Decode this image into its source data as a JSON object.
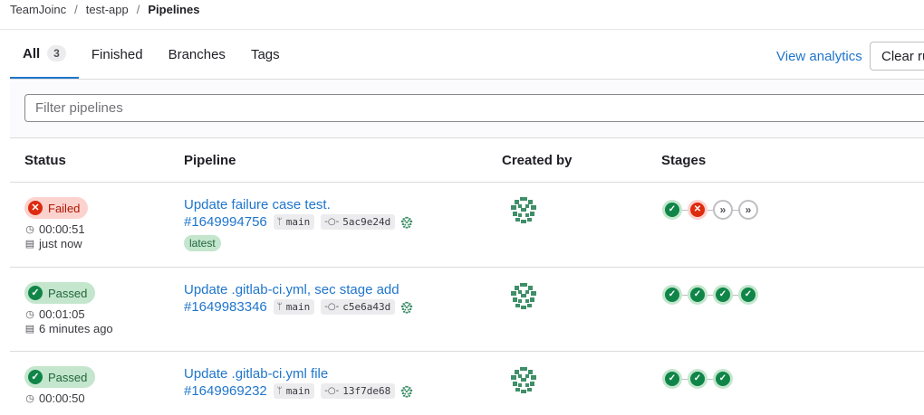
{
  "breadcrumb": {
    "group": "TeamJoinc",
    "project": "test-app",
    "page": "Pipelines"
  },
  "tabs": [
    {
      "label": "All",
      "count": "3",
      "active": true
    },
    {
      "label": "Finished"
    },
    {
      "label": "Branches"
    },
    {
      "label": "Tags"
    }
  ],
  "actions": {
    "analytics": "View analytics",
    "clear": "Clear ru"
  },
  "filter": {
    "placeholder": "Filter pipelines"
  },
  "columns": {
    "status": "Status",
    "pipeline": "Pipeline",
    "created_by": "Created by",
    "stages": "Stages"
  },
  "colors": {
    "link": "#1f75cb",
    "success": "#108548",
    "failed": "#dd2b0e"
  },
  "pipelines": [
    {
      "status": "Failed",
      "duration": "00:00:51",
      "finished": "just now",
      "title": "Update failure case test.",
      "id": "#1649994756",
      "ref": "main",
      "sha": "5ac9e24d",
      "tag": "latest",
      "stages": [
        "success",
        "failed",
        "skipped",
        "skipped"
      ]
    },
    {
      "status": "Passed",
      "duration": "00:01:05",
      "finished": "6 minutes ago",
      "title": "Update .gitlab-ci.yml, sec stage add",
      "id": "#1649983346",
      "ref": "main",
      "sha": "c5e6a43d",
      "stages": [
        "success",
        "success",
        "success",
        "success"
      ]
    },
    {
      "status": "Passed",
      "duration": "00:00:50",
      "title": "Update .gitlab-ci.yml file",
      "id": "#1649969232",
      "ref": "main",
      "sha": "13f7de68",
      "stages": [
        "success",
        "success",
        "success"
      ]
    }
  ]
}
